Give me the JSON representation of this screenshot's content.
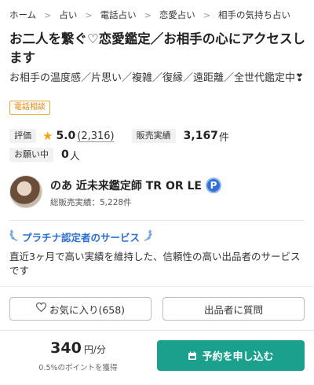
{
  "breadcrumb": [
    "ホーム",
    "占い",
    "電話占い",
    "恋愛占い",
    "相手の気持ち占い"
  ],
  "title": "お二人を繋ぐ♡恋愛鑑定／お相手の心にアクセスします",
  "subtitle": "お相手の温度感／片思い／複雑／復縁／遠距離／全世代鑑定中❣",
  "badge": "電話相談",
  "stats": {
    "eval_label": "評価",
    "rating": "5.0",
    "rating_count": "(2,316)",
    "sales_label": "販売実績",
    "sales_value": "3,167",
    "sales_unit": "件",
    "request_label": "お願い中",
    "request_value": "0",
    "request_unit": "人"
  },
  "seller": {
    "name": "のあ 近未来鑑定師 TR OR LE",
    "badge_letter": "P",
    "total_sales": "総販売実績：5,228件"
  },
  "platinum": {
    "label": "プラチナ認定者のサービス",
    "description": "直近3ヶ月で高い実績を維持した、信頼性の高い出品者のサービスです"
  },
  "buttons": {
    "favorite": "お気に入り(658)",
    "ask": "出品者に質問",
    "reserve": "予約を申し込む"
  },
  "price": {
    "amount": "340",
    "unit": "円/分",
    "points": "0.5%のポイントを獲得"
  },
  "colors": {
    "accent": "#1aa08d",
    "star": "#f0a500",
    "platinum": "#2d6fcf",
    "badge": "#e8a63a"
  }
}
